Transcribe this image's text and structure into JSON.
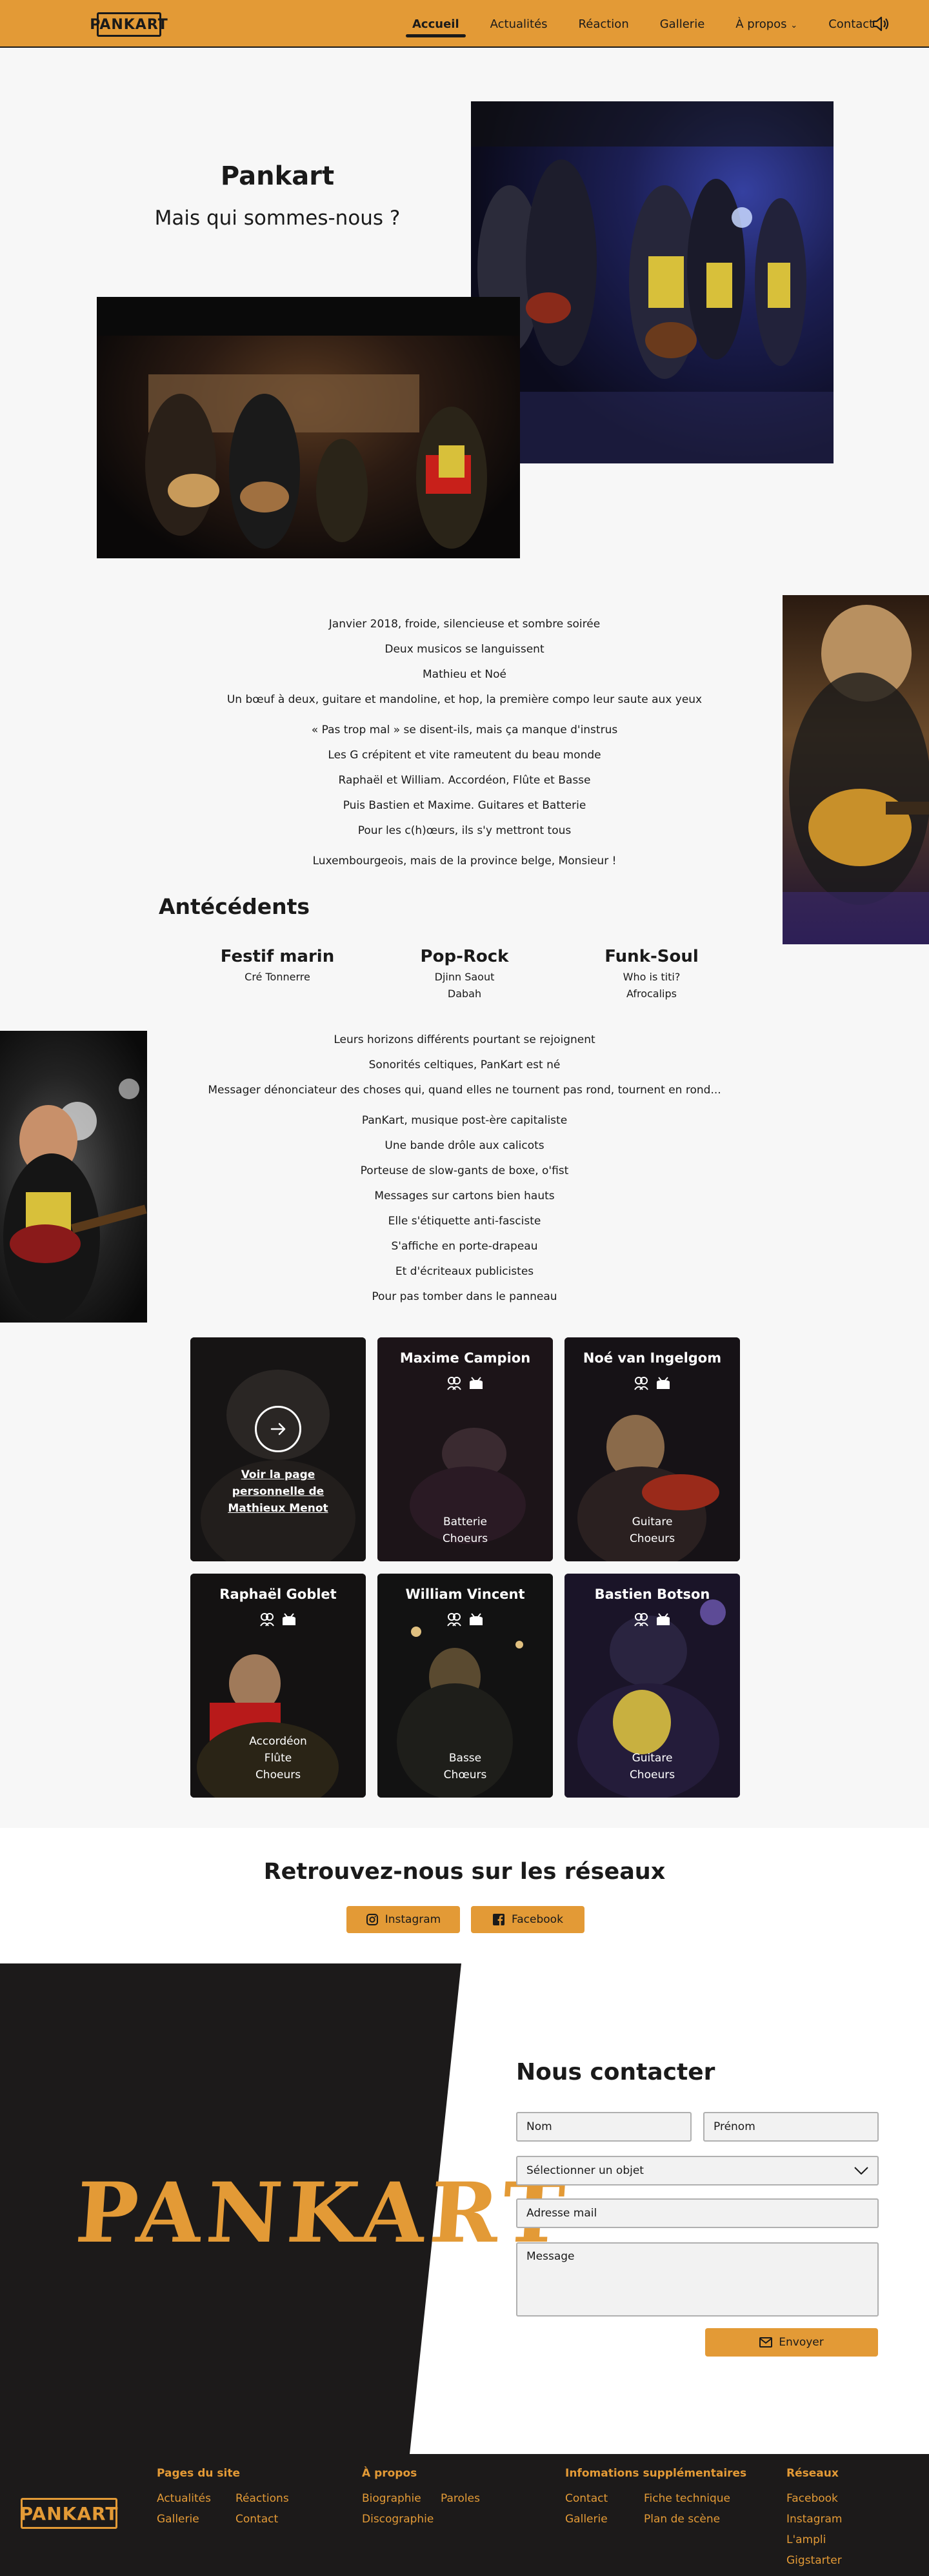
{
  "header": {
    "logo": "PANKART",
    "nav": [
      "Accueil",
      "Actualités",
      "Réaction",
      "Gallerie",
      "À propos",
      "Contact"
    ],
    "active_index": 0,
    "dropdown_suffix": "⌄",
    "speaker_icon": "speaker-muted-icon"
  },
  "hero": {
    "title": "Pankart",
    "subtitle": "Mais qui sommes-nous ?"
  },
  "story1": [
    "Janvier 2018, froide, silencieuse et sombre soirée",
    "Deux musicos se languissent",
    "Mathieu et Noé",
    "Un bœuf à deux, guitare et mandoline, et hop, la première compo leur saute aux yeux",
    "« Pas trop mal » se disent-ils, mais ça manque d'instrus",
    "Les G crépitent et vite rameutent du beau monde",
    "Raphaël et William. Accordéon, Flûte et Basse",
    "Puis Bastien et Maxime. Guitares et Batterie",
    "Pour les c(h)œurs, ils s'y mettront tous",
    "Luxembourgeois, mais de la province belge, Monsieur !"
  ],
  "antecedents": {
    "title": "Antécédents",
    "columns": [
      {
        "heading": "Festif marin",
        "items": [
          "Cré Tonnerre"
        ]
      },
      {
        "heading": "Pop-Rock",
        "items": [
          "Djinn Saout",
          "Dabah"
        ]
      },
      {
        "heading": "Funk-Soul",
        "items": [
          "Who is titi?",
          "Afrocalips"
        ]
      }
    ]
  },
  "story2": [
    "Leurs horizons différents pourtant se rejoignent",
    "Sonorités celtiques, PanKart est né",
    "Messager dénonciateur des choses qui, quand elles ne tournent pas rond, tournent en rond...",
    "PanKart, musique post-ère capitaliste",
    "Une bande drôle aux calicots",
    "Porteuse de slow-gants de boxe, o'fist",
    "Messages sur cartons bien hauts",
    "Elle s'étiquette anti-fasciste",
    "S'affiche en porte-drapeau",
    "Et d'écriteaux publicistes",
    "Pour pas tomber dans le panneau"
  ],
  "members": [
    {
      "name": "",
      "link": "Voir la page personnelle de Mathieux Menot",
      "roles": []
    },
    {
      "name": "Maxime Campion",
      "roles": [
        "Batterie",
        "Choeurs"
      ]
    },
    {
      "name": "Noé van Ingelgom",
      "roles": [
        "Guitare",
        "Choeurs"
      ]
    },
    {
      "name": "Raphaël Goblet",
      "roles": [
        "Accordéon",
        "Flûte",
        "Choeurs"
      ]
    },
    {
      "name": "William Vincent",
      "roles": [
        "Basse",
        "Chœurs"
      ]
    },
    {
      "name": "Bastien Botson",
      "roles": [
        "Guitare",
        "Choeurs"
      ]
    }
  ],
  "social": {
    "title": "Retrouvez-nous sur les réseaux",
    "instagram": "Instagram",
    "facebook": "Facebook"
  },
  "contact": {
    "logo": "PANKART",
    "title": "Nous contacter",
    "nom": "Nom",
    "prenom": "Prénom",
    "objet": "Sélectionner un objet",
    "email": "Adresse mail",
    "message": "Message",
    "send": "Envoyer"
  },
  "footer": {
    "logo": "PANKART",
    "pages_title": "Pages du site",
    "pages": [
      "Actualités",
      "Réactions",
      "Gallerie",
      "Contact"
    ],
    "apropos_title": "À propos",
    "apropos": [
      "Biographie",
      "Paroles",
      "Discographie"
    ],
    "infos_title": "Infomations supplémentaires",
    "infos": [
      "Contact",
      "Fiche technique",
      "Gallerie",
      "Plan de scène"
    ],
    "reseaux_title": "Réseaux",
    "reseaux": [
      "Facebook",
      "Instagram",
      "L'ampli",
      "Gigstarter"
    ]
  },
  "colors": {
    "accent": "#e39a36",
    "dark": "#1c1a1a",
    "page": "#f7f7f7"
  }
}
